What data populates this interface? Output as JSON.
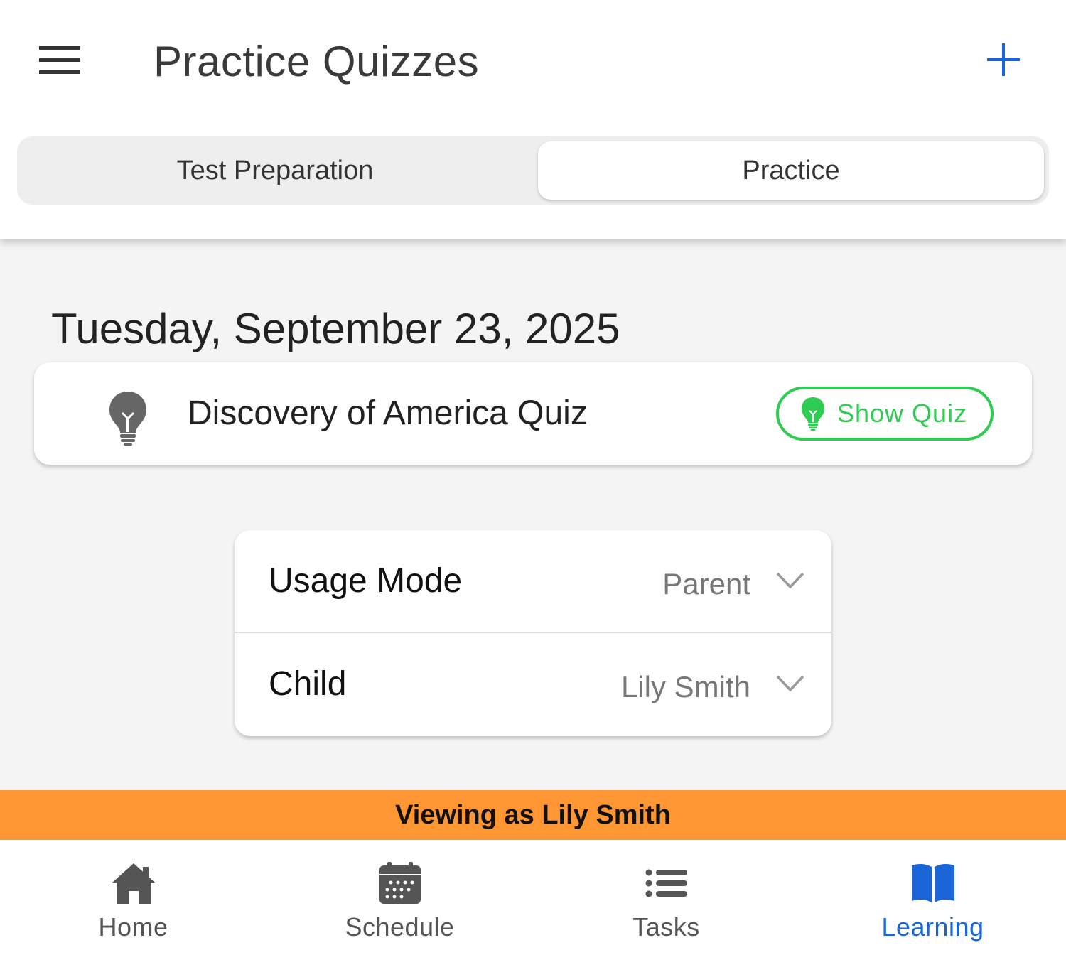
{
  "header": {
    "title": "Practice Quizzes",
    "menu_icon": "hamburger-menu-icon",
    "add_icon": "plus-icon",
    "accent_color": "#1a66d8"
  },
  "tabs": [
    {
      "label": "Test Preparation",
      "selected": false
    },
    {
      "label": "Practice",
      "selected": true
    }
  ],
  "content": {
    "date": "Tuesday, September 23, 2025",
    "quiz": {
      "title": "Discovery of America Quiz",
      "icon": "lightbulb-icon",
      "button_label": "Show Quiz",
      "button_color": "#2fcb52"
    }
  },
  "settings": {
    "usage_mode": {
      "label": "Usage Mode",
      "value": "Parent"
    },
    "child": {
      "label": "Child",
      "value": "Lily Smith"
    }
  },
  "banner": {
    "text": "Viewing as Lily Smith",
    "color": "#fe9633"
  },
  "bottom_nav": [
    {
      "label": "Home",
      "icon": "home-icon",
      "active": false
    },
    {
      "label": "Schedule",
      "icon": "calendar-icon",
      "active": false
    },
    {
      "label": "Tasks",
      "icon": "list-icon",
      "active": false
    },
    {
      "label": "Learning",
      "icon": "book-icon",
      "active": true
    }
  ]
}
